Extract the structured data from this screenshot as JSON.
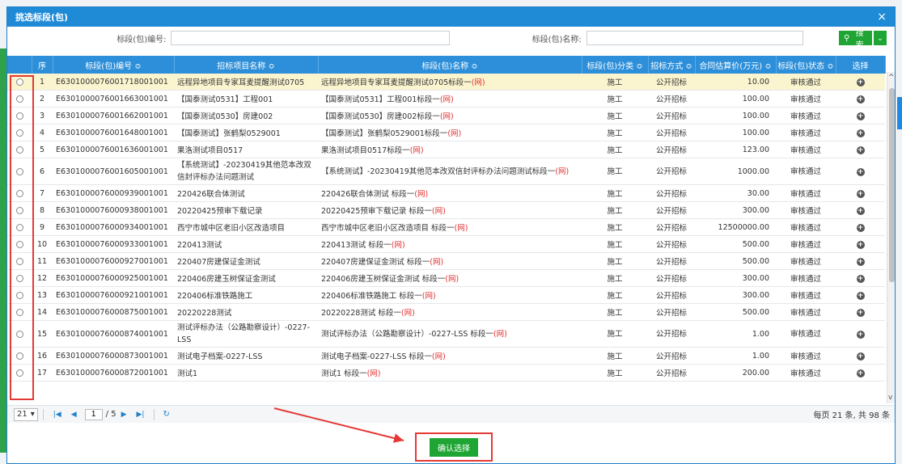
{
  "dialog": {
    "title": "挑选标段(包)",
    "close_symbol": "×"
  },
  "search": {
    "code_label": "标段(包)编号:",
    "code_value": "",
    "name_label": "标段(包)名称:",
    "name_value": "",
    "search_button": "搜索",
    "more_button": "⌄"
  },
  "columns": {
    "seq": "序",
    "code": "标段(包)编号 ≎",
    "project": "招标项目名称 ≎",
    "name": "标段(包)名称 ≎",
    "category": "标段(包)分类 ≎",
    "method": "招标方式 ≎",
    "price": "合同估算价(万元) ≎",
    "status": "标段(包)状态 ≎",
    "choose": "选择"
  },
  "rows": [
    {
      "seq": "1",
      "code": "E6301000076001718001001",
      "project": "远程异地项目专家耳麦提醒测试0705",
      "name": "远程异地项目专家耳麦提醒测试0705标段一",
      "tag": "(网)",
      "category": "施工",
      "method": "公开招标",
      "price": "10.00",
      "status": "审核通过"
    },
    {
      "seq": "2",
      "code": "E6301000076001663001001",
      "project": "【国泰测试0531】工程001",
      "name": "【国泰测试0531】工程001标段一",
      "tag": "(网)",
      "category": "施工",
      "method": "公开招标",
      "price": "100.00",
      "status": "审核通过"
    },
    {
      "seq": "3",
      "code": "E6301000076001662001001",
      "project": "【国泰测试0530】房建002",
      "name": "【国泰测试0530】房建002标段一",
      "tag": "(网)",
      "category": "施工",
      "method": "公开招标",
      "price": "100.00",
      "status": "审核通过"
    },
    {
      "seq": "4",
      "code": "E6301000076001648001001",
      "project": "【国泰测试】张鹤梨0529001",
      "name": "【国泰测试】张鹤梨0529001标段一",
      "tag": "(网)",
      "category": "施工",
      "method": "公开招标",
      "price": "100.00",
      "status": "审核通过"
    },
    {
      "seq": "5",
      "code": "E6301000076001636001001",
      "project": "果洛测试项目0517",
      "name": "果洛测试项目0517标段一",
      "tag": "(网)",
      "category": "施工",
      "method": "公开招标",
      "price": "123.00",
      "status": "审核通过"
    },
    {
      "seq": "6",
      "code": "E6301000076001605001001",
      "project": "【系统测试】-20230419其他范本改双信封评标办法问题测试",
      "name": "【系统测试】-20230419其他范本改双信封评标办法问题测试标段一",
      "tag": "(网)",
      "category": "施工",
      "method": "公开招标",
      "price": "1000.00",
      "status": "审核通过"
    },
    {
      "seq": "7",
      "code": "E6301000076000939001001",
      "project": "220426联合体测试",
      "name": "220426联合体测试 标段一",
      "tag": "(网)",
      "category": "施工",
      "method": "公开招标",
      "price": "30.00",
      "status": "审核通过"
    },
    {
      "seq": "8",
      "code": "E6301000076000938001001",
      "project": "20220425预审下载记录",
      "name": "20220425预审下载记录 标段一",
      "tag": "(网)",
      "category": "施工",
      "method": "公开招标",
      "price": "300.00",
      "status": "审核通过"
    },
    {
      "seq": "9",
      "code": "E6301000076000934001001",
      "project": "西宁市城中区老旧小区改造项目",
      "name": "西宁市城中区老旧小区改造项目 标段一",
      "tag": "(网)",
      "category": "施工",
      "method": "公开招标",
      "price": "12500000.00",
      "status": "审核通过"
    },
    {
      "seq": "10",
      "code": "E6301000076000933001001",
      "project": "220413测试",
      "name": "220413测试 标段一",
      "tag": "(网)",
      "category": "施工",
      "method": "公开招标",
      "price": "500.00",
      "status": "审核通过"
    },
    {
      "seq": "11",
      "code": "E6301000076000927001001",
      "project": "220407房建保证金测试",
      "name": "220407房建保证金测试 标段一",
      "tag": "(网)",
      "category": "施工",
      "method": "公开招标",
      "price": "500.00",
      "status": "审核通过"
    },
    {
      "seq": "12",
      "code": "E6301000076000925001001",
      "project": "220406房建玉树保证金测试",
      "name": "220406房建玉树保证金测试 标段一",
      "tag": "(网)",
      "category": "施工",
      "method": "公开招标",
      "price": "300.00",
      "status": "审核通过"
    },
    {
      "seq": "13",
      "code": "E6301000076000921001001",
      "project": "220406标准铁路施工",
      "name": "220406标准铁路施工 标段一",
      "tag": "(网)",
      "category": "施工",
      "method": "公开招标",
      "price": "300.00",
      "status": "审核通过"
    },
    {
      "seq": "14",
      "code": "E6301000076000875001001",
      "project": "20220228测试",
      "name": "20220228测试 标段一",
      "tag": "(网)",
      "category": "施工",
      "method": "公开招标",
      "price": "500.00",
      "status": "审核通过"
    },
    {
      "seq": "15",
      "code": "E6301000076000874001001",
      "project": "测试评标办法（公路勘察设计）-0227-LSS",
      "name": "测试评标办法（公路勘察设计）-0227-LSS 标段一",
      "tag": "(网)",
      "category": "施工",
      "method": "公开招标",
      "price": "1.00",
      "status": "审核通过"
    },
    {
      "seq": "16",
      "code": "E6301000076000873001001",
      "project": "测试电子档案-0227-LSS",
      "name": "测试电子档案-0227-LSS 标段一",
      "tag": "(网)",
      "category": "施工",
      "method": "公开招标",
      "price": "1.00",
      "status": "审核通过"
    },
    {
      "seq": "17",
      "code": "E6301000076000872001001",
      "project": "测试1",
      "name": "测试1 标段一",
      "tag": "(网)",
      "category": "施工",
      "method": "公开招标",
      "price": "200.00",
      "status": "审核通过"
    }
  ],
  "pager": {
    "page_size": "21",
    "page_current": "1",
    "page_total": "/ 5",
    "summary": "每页 21 条, 共 98 条"
  },
  "confirm_button": "确认选择",
  "accent": "#1f8ad6",
  "success": "#1ea533",
  "highlight": "#e53935"
}
